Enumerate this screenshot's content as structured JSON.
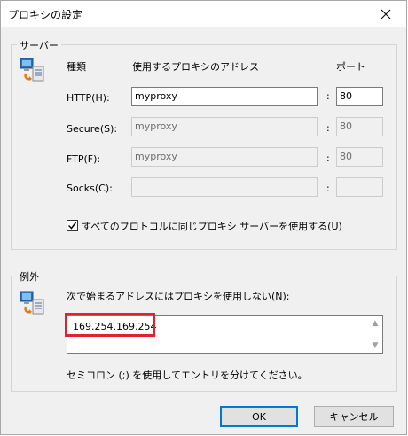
{
  "window": {
    "title": "プロキシの設定"
  },
  "servers": {
    "group_label": "サーバー",
    "col_type": "種類",
    "col_address": "使用するプロキシのアドレス",
    "col_port": "ポート",
    "colon": ":",
    "rows": [
      {
        "label": "HTTP(H):",
        "address": "myproxy",
        "port": "80",
        "enabled": true
      },
      {
        "label": "Secure(S):",
        "address": "myproxy",
        "port": "80",
        "enabled": false
      },
      {
        "label": "FTP(F):",
        "address": "myproxy",
        "port": "80",
        "enabled": false
      },
      {
        "label": "Socks(C):",
        "address": "",
        "port": "",
        "enabled": false
      }
    ],
    "same_proxy_checkbox": {
      "label": "すべてのプロトコルに同じプロキシ サーバーを使用する(U)",
      "checked": true
    }
  },
  "exceptions": {
    "group_label": "例外",
    "prompt": "次で始まるアドレスにはプロキシを使用しない(N):",
    "value": "169.254.169.254",
    "hint": "セミコロン (;) を使用してエントリを分けてください。"
  },
  "buttons": {
    "ok": "OK",
    "cancel": "キャンセル"
  },
  "colors": {
    "highlight": "#e5202e",
    "accent": "#0078d7"
  },
  "icons": {
    "server_icon": "network-computer-icon",
    "exception_icon": "network-computer-icon"
  }
}
